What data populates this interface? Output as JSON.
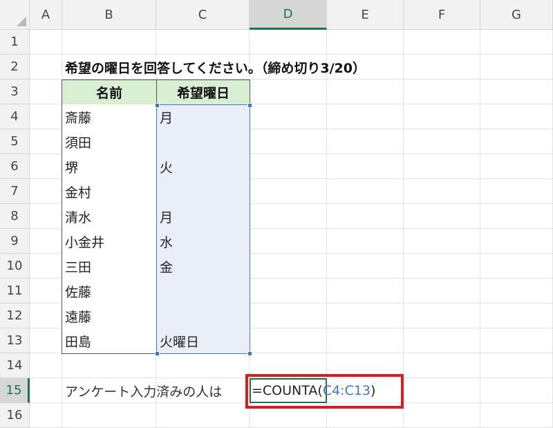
{
  "columns": [
    "A",
    "B",
    "C",
    "D",
    "E",
    "F",
    "G"
  ],
  "active_column": "D",
  "rows": [
    "1",
    "2",
    "3",
    "4",
    "5",
    "6",
    "7",
    "8",
    "9",
    "10",
    "11",
    "12",
    "13",
    "14",
    "15",
    "16"
  ],
  "active_row": "15",
  "title": "希望の曜日を回答してください。（締め切り3/20）",
  "table": {
    "headers": [
      "名前",
      "希望曜日"
    ],
    "rows": [
      {
        "name": "斎藤",
        "day": "月"
      },
      {
        "name": "須田",
        "day": ""
      },
      {
        "name": "堺",
        "day": "火"
      },
      {
        "name": "金村",
        "day": ""
      },
      {
        "name": "清水",
        "day": "月"
      },
      {
        "name": "小金井",
        "day": "水"
      },
      {
        "name": "三田",
        "day": "金"
      },
      {
        "name": "佐藤",
        "day": ""
      },
      {
        "name": "遠藤",
        "day": ""
      },
      {
        "name": "田島",
        "day": "火曜日"
      }
    ]
  },
  "summary_label": "アンケート入力済みの人は",
  "formula": {
    "prefix": "=COUNTA(",
    "range": "C4:C13",
    "suffix": ")"
  },
  "colors": {
    "header_fill": "#d9efd2",
    "selection_fill": "#e9eef9",
    "range_ref": "#4472c4",
    "active_cell_border": "#217346",
    "highlight_box": "#e0191a"
  }
}
